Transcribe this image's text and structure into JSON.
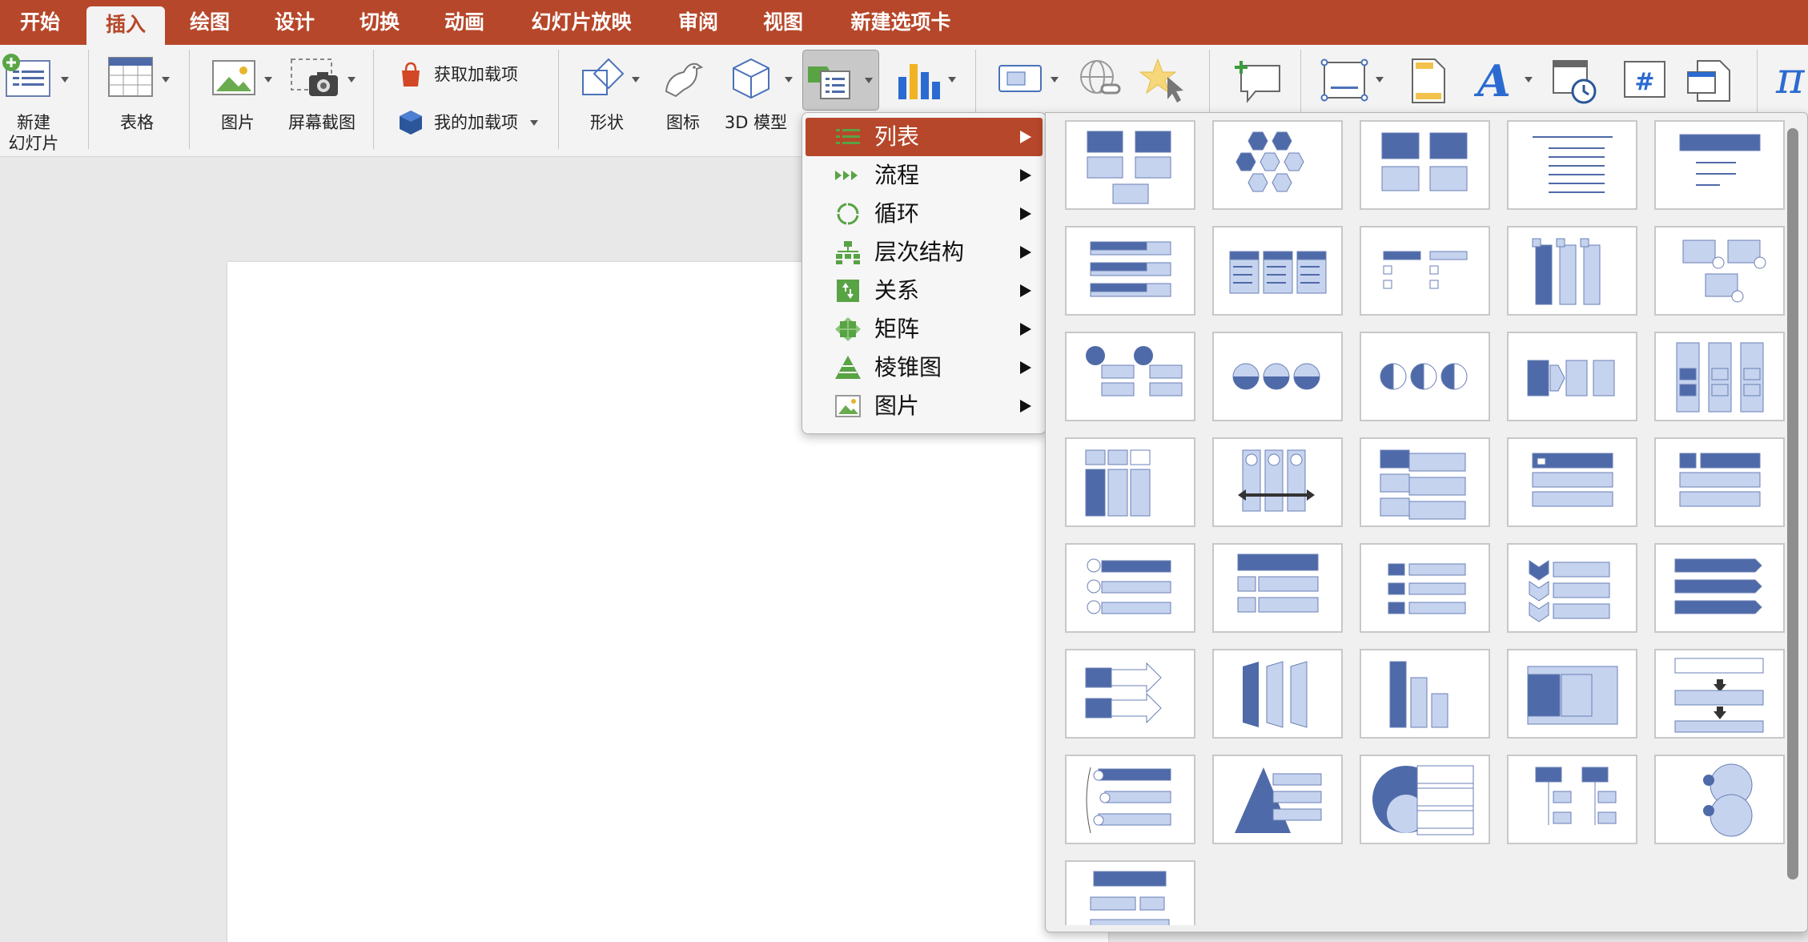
{
  "tabs": [
    "开始",
    "插入",
    "绘图",
    "设计",
    "切换",
    "动画",
    "幻灯片放映",
    "审阅",
    "视图",
    "新建选项卡"
  ],
  "active_tab": "插入",
  "ribbon": {
    "new_slide": "新建\n幻灯片",
    "table": "表格",
    "pictures": "图片",
    "screenshot": "屏幕截图",
    "get_addins": "获取加载项",
    "my_addins": "我的加载项",
    "shapes": "形状",
    "icons": "图标",
    "model3d": "3D 模型",
    "cut_labels": [
      "…",
      "链接",
      "动作",
      "批注",
      "文本框",
      "页眉和…",
      "艺术字",
      "日期和…",
      "幻灯片…",
      "对象",
      "公…"
    ]
  },
  "smartart_menu": [
    {
      "label": "列表",
      "icon": "list-icon",
      "selected": true
    },
    {
      "label": "流程",
      "icon": "process-icon"
    },
    {
      "label": "循环",
      "icon": "cycle-icon"
    },
    {
      "label": "层次结构",
      "icon": "hierarchy-icon"
    },
    {
      "label": "关系",
      "icon": "relationship-icon"
    },
    {
      "label": "矩阵",
      "icon": "matrix-icon"
    },
    {
      "label": "棱锥图",
      "icon": "pyramid-icon"
    },
    {
      "label": "图片",
      "icon": "picture-icon"
    }
  ],
  "colors": {
    "accent": "#b7472a",
    "smartart_dark": "#4f6aa8",
    "smartart_light": "#c5d3ee",
    "menu_icon_green": "#58a344"
  },
  "gallery_layout_count": 36
}
